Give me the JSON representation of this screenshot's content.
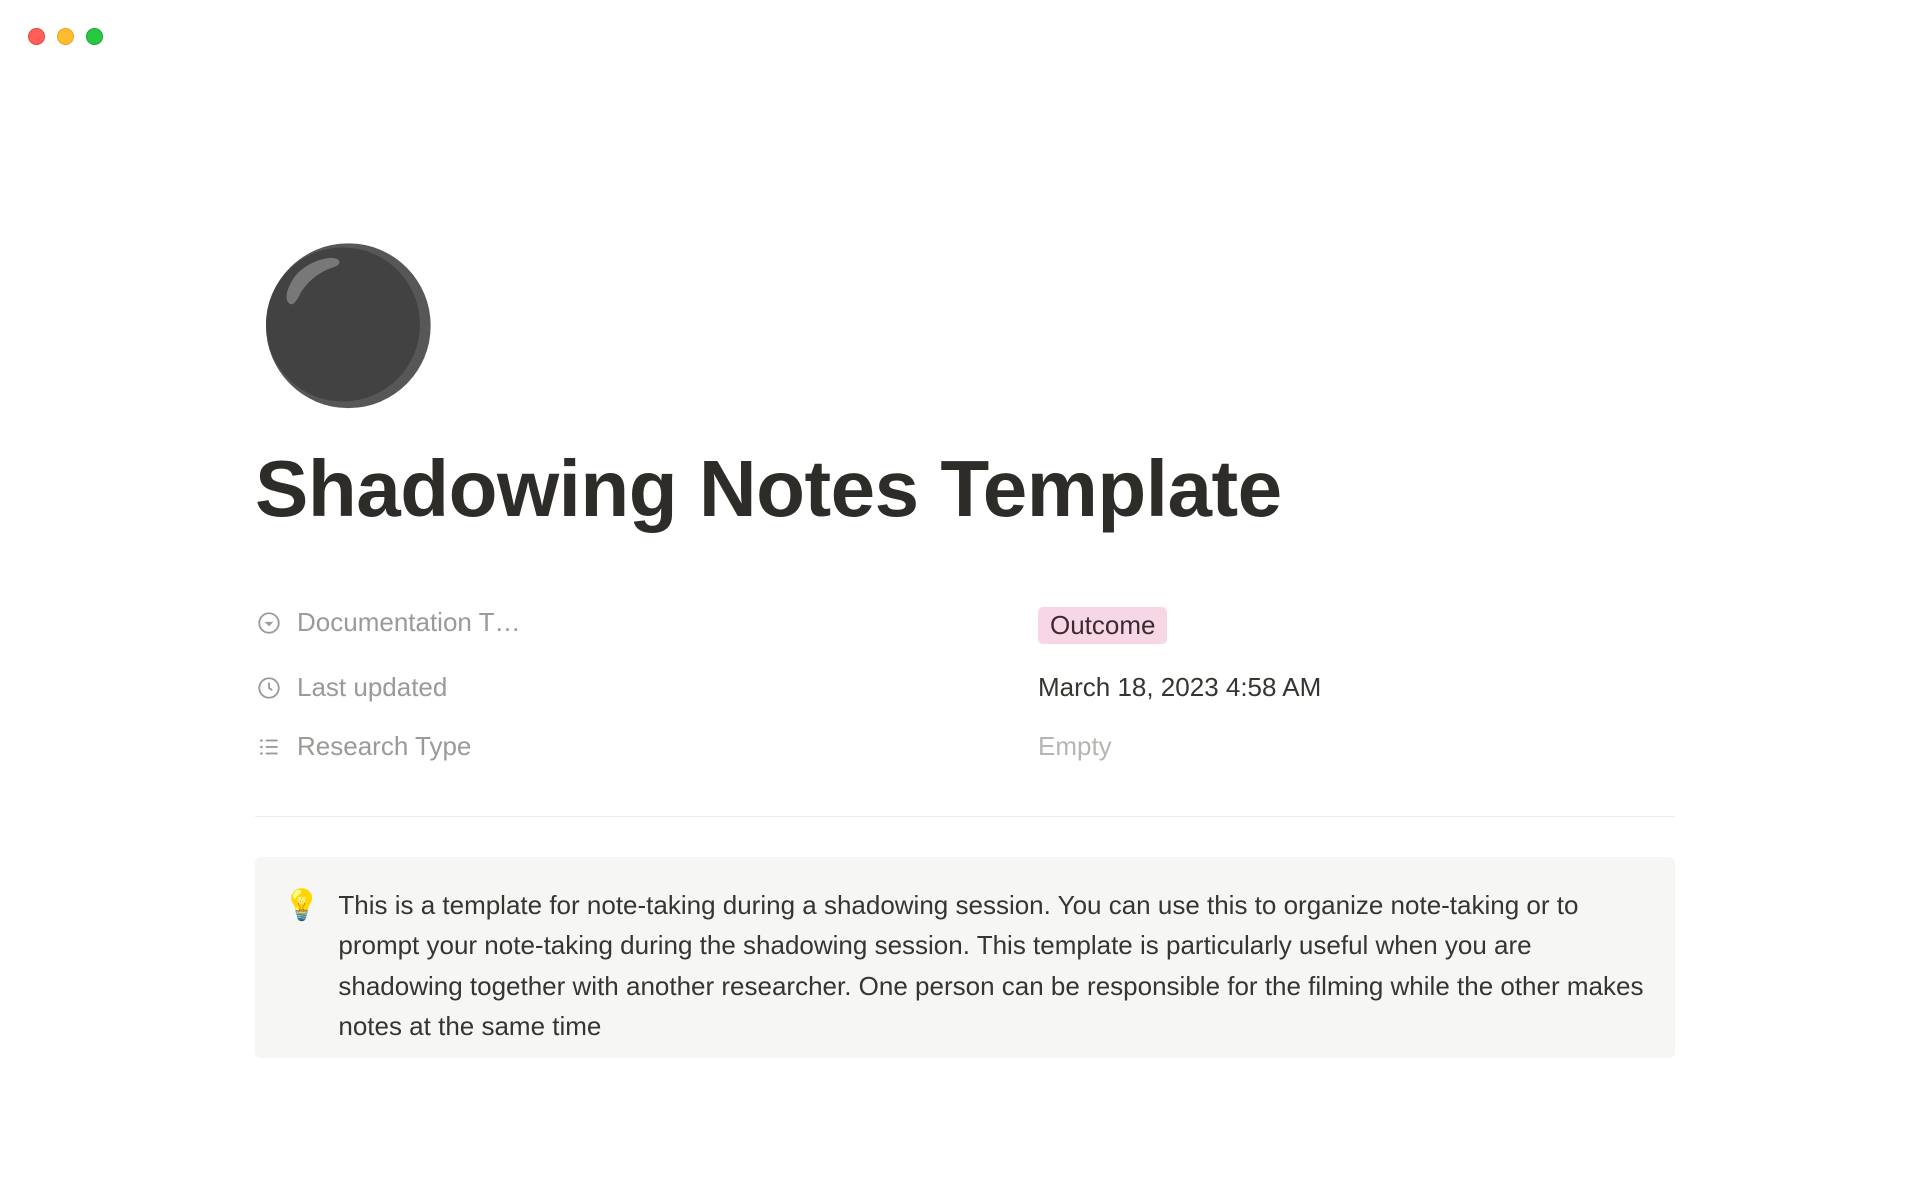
{
  "window": {
    "traffic": {
      "close": "#ff5f57",
      "min": "#febc2e",
      "max": "#28c840"
    }
  },
  "page": {
    "icon": "⚫",
    "title": "Shadowing Notes Template"
  },
  "properties": [
    {
      "icon": "select",
      "label": "Documentation T…",
      "value_type": "tag",
      "value": "Outcome"
    },
    {
      "icon": "clock",
      "label": "Last updated",
      "value_type": "text",
      "value": "March 18, 2023 4:58 AM"
    },
    {
      "icon": "list",
      "label": "Research Type",
      "value_type": "empty",
      "value": "Empty"
    }
  ],
  "callout": {
    "icon": "💡",
    "text": "This is a template for note-taking during a shadowing session. You can use this to organize note-taking or to prompt your note-taking during the shadowing session. This template is particularly useful when you are shadowing together with another researcher. One person can be responsible for the filming while the other makes notes at the same time"
  }
}
